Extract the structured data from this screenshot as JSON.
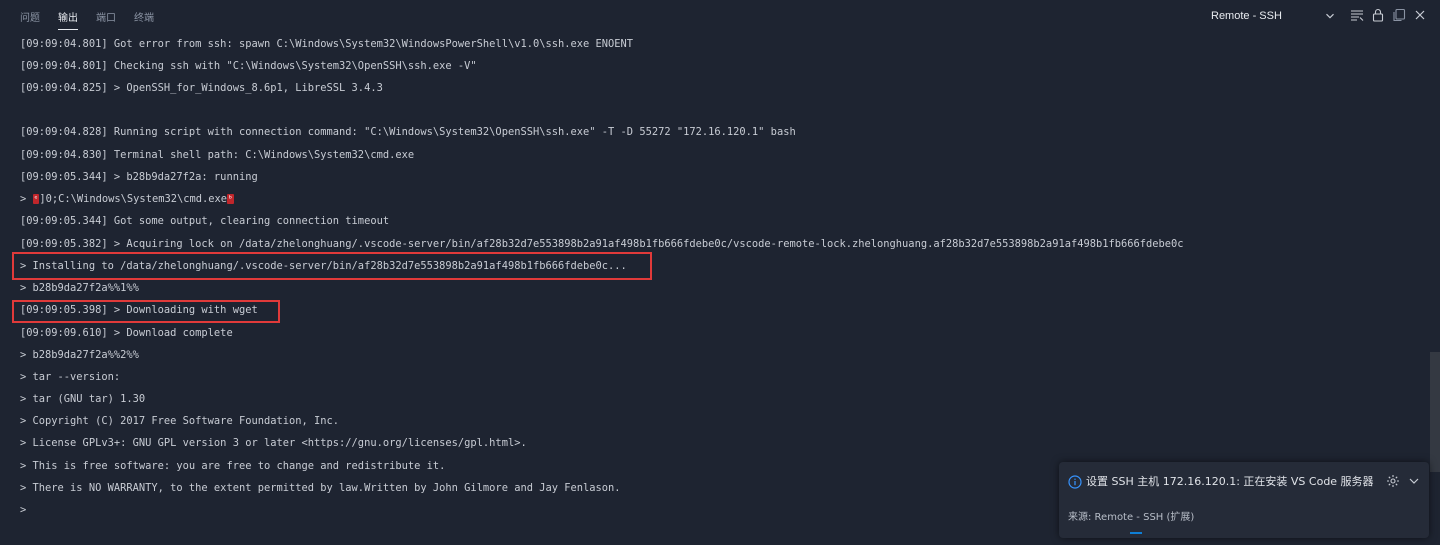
{
  "tabs": [
    {
      "label": "问题",
      "active": false
    },
    {
      "label": "输出",
      "active": true
    },
    {
      "label": "端口",
      "active": false
    },
    {
      "label": "终端",
      "active": false
    }
  ],
  "channel_selector": {
    "value": "Remote - SSH"
  },
  "actions": [
    "filter-lines-icon",
    "lock-scroll-icon",
    "copy-icon",
    "close-icon"
  ],
  "colors": {
    "background": "#1e2431",
    "text": "#c8ccd4",
    "highlight_border": "#e03a3a",
    "toast_background": "#252b38",
    "info_accent": "#3794ff",
    "progress": "#0e7fd6"
  },
  "log_lines": [
    "[09:09:04.801] Got error from ssh: spawn C:\\Windows\\System32\\WindowsPowerShell\\v1.0\\ssh.exe ENOENT",
    "[09:09:04.801] Checking ssh with \"C:\\Windows\\System32\\OpenSSH\\ssh.exe -V\"",
    "[09:09:04.825] > OpenSSH_for_Windows_8.6p1, LibreSSL 3.4.3",
    "",
    "[09:09:04.828] Running script with connection command: \"C:\\Windows\\System32\\OpenSSH\\ssh.exe\" -T -D 55272 \"172.16.120.1\" bash",
    "[09:09:04.830] Terminal shell path: C:\\Windows\\System32\\cmd.exe",
    "[09:09:05.344] > b28b9da27f2a: running",
    "",
    "[09:09:05.344] Got some output, clearing connection timeout",
    "[09:09:05.382] > Acquiring lock on /data/zhelonghuang/.vscode-server/bin/af28b32d7e553898b2a91af498b1fb666fdebe0c/vscode-remote-lock.zhelonghuang.af28b32d7e553898b2a91af498b1fb666fdebe0c",
    "> Installing to /data/zhelonghuang/.vscode-server/bin/af28b32d7e553898b2a91af498b1fb666fdebe0c...",
    "> b28b9da27f2a%%1%%",
    "[09:09:05.398] > Downloading with wget",
    "[09:09:09.610] > Download complete",
    "> b28b9da27f2a%%2%%",
    "> tar --version:",
    "> tar (GNU tar) 1.30",
    "> Copyright (C) 2017 Free Software Foundation, Inc.",
    "> License GPLv3+: GNU GPL version 3 or later <https://gnu.org/licenses/gpl.html>.",
    "> This is free software: you are free to change and redistribute it.",
    "> There is NO WARRANTY, to the extent permitted by law.Written by John Gilmore and Jay Fenlason.",
    ">"
  ],
  "escape_line": {
    "prefix": "> ",
    "esc_glyph": "ᵉ",
    "middle": "]0;C:\\Windows\\System32\\cmd.exe",
    "bel_glyph": "ᵇ"
  },
  "notification": {
    "message": "设置 SSH 主机 172.16.120.1: 正在安装 VS Code 服务器",
    "source": "来源: Remote - SSH (扩展)"
  }
}
